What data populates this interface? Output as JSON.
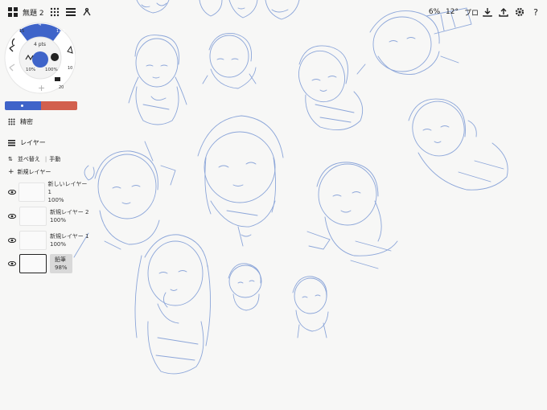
{
  "colors": {
    "stroke": "#6f8fd0",
    "accent_blue": "#3f64c9",
    "primary_swatch": "#3f64c9",
    "secondary_swatch": "#d2604e",
    "selected_layer_bg": "#d9d9d9"
  },
  "topbar": {
    "document_title": "無題 2",
    "zoom": "6%",
    "rotation": "12°",
    "pro_label": "プロ",
    "icons": [
      "grid-icon",
      "dots-grid-icon",
      "layers-stack-icon",
      "tool-icon",
      "import-icon",
      "export-icon",
      "settings-gear-icon",
      "help-icon"
    ]
  },
  "brush_wheel": {
    "size_label": "4 pts",
    "opacity_left": "10%",
    "opacity_right": "100%",
    "ring_numbers": [
      "15",
      "4",
      "17.5",
      "10",
      "20",
      "25"
    ],
    "plus": "+"
  },
  "sidebar": {
    "precision_label": "精密",
    "layers_title": "レイヤー",
    "sort_label": "並べ替え",
    "sort_mode": "手動",
    "new_layer_label": "新規レイヤー",
    "layers": [
      {
        "name": "新しいレイヤー 1",
        "opacity": "100%"
      },
      {
        "name": "新規レイヤー 2",
        "opacity": "100%"
      },
      {
        "name": "新規レイヤー 1",
        "opacity": "100%"
      },
      {
        "name": "鉛筆",
        "opacity": "98%"
      }
    ]
  }
}
